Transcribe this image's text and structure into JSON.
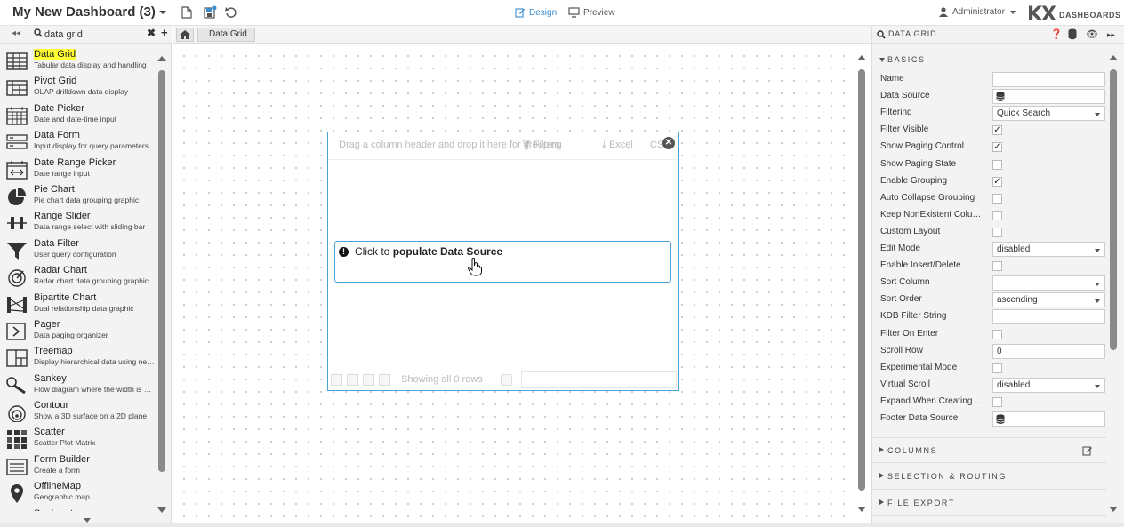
{
  "header": {
    "title": "My New Dashboard (3)",
    "design_label": "Design",
    "preview_label": "Preview",
    "user_label": "Administrator",
    "logo_text": "KX",
    "logo_sub": "DASHBOARDS"
  },
  "left": {
    "search_value": "data grid",
    "items": [
      {
        "name": "Data Grid",
        "desc": "Tabular data display and handling",
        "icon": "grid-icon"
      },
      {
        "name": "Pivot Grid",
        "desc": "OLAP drilldown data display",
        "icon": "pivot-grid-icon"
      },
      {
        "name": "Date Picker",
        "desc": "Date and date-time input",
        "icon": "calendar-icon"
      },
      {
        "name": "Data Form",
        "desc": "Input display for query parameters",
        "icon": "form-icon"
      },
      {
        "name": "Date Range Picker",
        "desc": "Date range input",
        "icon": "date-range-icon"
      },
      {
        "name": "Pie Chart",
        "desc": "Pie chart data grouping graphic",
        "icon": "pie-chart-icon"
      },
      {
        "name": "Range Slider",
        "desc": "Data range select with sliding bar",
        "icon": "range-slider-icon"
      },
      {
        "name": "Data Filter",
        "desc": "User query configuration",
        "icon": "filter-icon"
      },
      {
        "name": "Radar Chart",
        "desc": "Radar chart data grouping graphic",
        "icon": "radar-chart-icon"
      },
      {
        "name": "Bipartite Chart",
        "desc": "Dual relationship data graphic",
        "icon": "bipartite-icon"
      },
      {
        "name": "Pager",
        "desc": "Data paging organizer",
        "icon": "pager-icon"
      },
      {
        "name": "Treemap",
        "desc": "Display hierarchical data using nested rectangles",
        "icon": "treemap-icon"
      },
      {
        "name": "Sankey",
        "desc": "Flow diagram where the width is proportional",
        "icon": "sankey-icon"
      },
      {
        "name": "Contour",
        "desc": "Show a 3D surface on a 2D plane",
        "icon": "contour-icon"
      },
      {
        "name": "Scatter",
        "desc": "Scatter Plot Matrix",
        "icon": "scatter-icon"
      },
      {
        "name": "Form Builder",
        "desc": "Create a form",
        "icon": "form-builder-icon"
      },
      {
        "name": "OfflineMap",
        "desc": "Geographic map",
        "icon": "map-pin-icon"
      },
      {
        "name": "Sunburst",
        "desc": "",
        "icon": "sunburst-icon"
      }
    ]
  },
  "breadcrumb": {
    "current": "Data Grid"
  },
  "widget": {
    "group_hint": "Drag a column header and drop it here for grouping",
    "filters_label": "Filters",
    "excel_label": "Excel",
    "csv_label": "CS",
    "populate_prefix": "Click to ",
    "populate_bold": "populate Data Source",
    "rows_text": "Showing all 0 rows"
  },
  "right": {
    "header_title": "DATA GRID",
    "sections": {
      "basics": "BASICS",
      "columns": "COLUMNS",
      "selection": "SELECTION & ROUTING",
      "export": "FILE EXPORT"
    },
    "props": [
      {
        "label": "Name",
        "type": "input",
        "value": ""
      },
      {
        "label": "Data Source",
        "type": "ds",
        "value": ""
      },
      {
        "label": "Filtering",
        "type": "select",
        "value": "Quick Search"
      },
      {
        "label": "Filter Visible",
        "type": "check",
        "checked": true
      },
      {
        "label": "Show Paging Control",
        "type": "check",
        "checked": true
      },
      {
        "label": "Show Paging State",
        "type": "check",
        "checked": false
      },
      {
        "label": "Enable Grouping",
        "type": "check",
        "checked": true
      },
      {
        "label": "Auto Collapse Grouping",
        "type": "check",
        "checked": false
      },
      {
        "label": "Keep NonExistent Columns",
        "type": "check",
        "checked": false
      },
      {
        "label": "Custom Layout",
        "type": "check",
        "checked": false
      },
      {
        "label": "Edit Mode",
        "type": "select",
        "value": "disabled"
      },
      {
        "label": "Enable Insert/Delete",
        "type": "check",
        "checked": false
      },
      {
        "label": "Sort Column",
        "type": "select",
        "value": ""
      },
      {
        "label": "Sort Order",
        "type": "select",
        "value": "ascending"
      },
      {
        "label": "KDB Filter String",
        "type": "input",
        "value": ""
      },
      {
        "label": "Filter On Enter",
        "type": "check",
        "checked": false
      },
      {
        "label": "Scroll Row",
        "type": "input",
        "value": "0"
      },
      {
        "label": "Experimental Mode",
        "type": "check",
        "checked": false
      },
      {
        "label": "Virtual Scroll",
        "type": "select",
        "value": "disabled"
      },
      {
        "label": "Expand When Creating Groups",
        "type": "check",
        "checked": false
      },
      {
        "label": "Footer Data Source",
        "type": "ds",
        "value": ""
      }
    ]
  },
  "colors": {
    "accent": "#3c8dce",
    "highlight": "#ffff33",
    "border_blue": "#4aa3d6"
  }
}
